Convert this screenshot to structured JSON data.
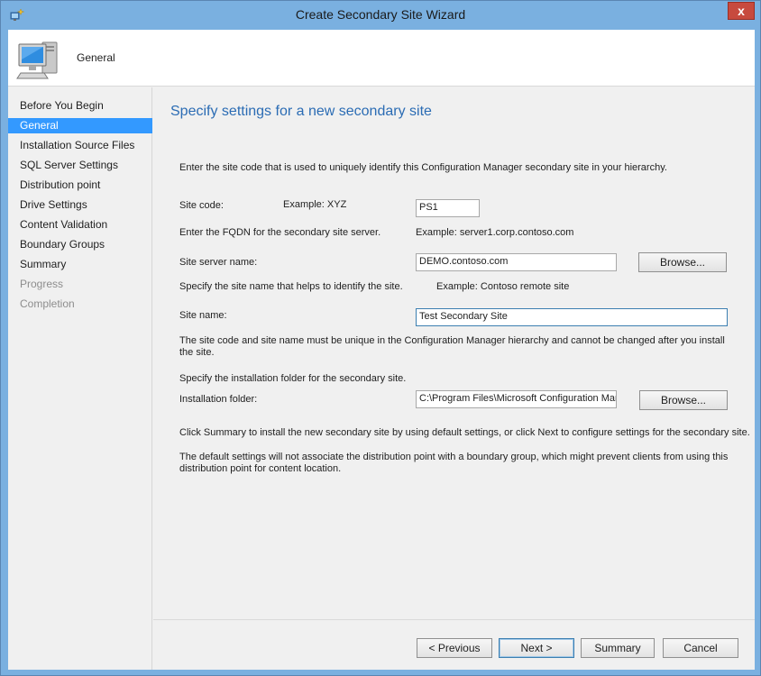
{
  "window": {
    "title": "Create Secondary Site Wizard",
    "close_label": "x"
  },
  "header": {
    "title": "General",
    "icon": "computer-icon"
  },
  "nav": {
    "items": [
      {
        "label": "Before You Begin",
        "state": "normal"
      },
      {
        "label": "General",
        "state": "selected"
      },
      {
        "label": "Installation Source Files",
        "state": "normal"
      },
      {
        "label": "SQL Server Settings",
        "state": "normal"
      },
      {
        "label": "Distribution point",
        "state": "normal"
      },
      {
        "label": "Drive Settings",
        "state": "normal"
      },
      {
        "label": "Content Validation",
        "state": "normal"
      },
      {
        "label": "Boundary Groups",
        "state": "normal"
      },
      {
        "label": "Summary",
        "state": "normal"
      },
      {
        "label": "Progress",
        "state": "disabled"
      },
      {
        "label": "Completion",
        "state": "disabled"
      }
    ]
  },
  "page": {
    "heading": "Specify settings for a new secondary site",
    "intro": "Enter the site code that is used to uniquely identify this Configuration Manager secondary site in your hierarchy.",
    "site_code": {
      "label": "Site code:",
      "example": "Example: XYZ",
      "value": "PS1"
    },
    "fqdn_note": "Enter the FQDN for the secondary site server.",
    "fqdn_example": "Example: server1.corp.contoso.com",
    "site_server": {
      "label": "Site server name:",
      "value": "DEMO.contoso.com",
      "browse_label": "Browse..."
    },
    "site_name_note": "Specify the site name that helps to identify the site.",
    "site_name_example": "Example: Contoso remote site",
    "site_name": {
      "label": "Site name:",
      "value": "Test Secondary Site"
    },
    "unique_note": "The site code and site name must be unique in the Configuration Manager hierarchy and cannot be changed after you install the site.",
    "folder_note": "Specify the installation folder for the secondary site.",
    "install_folder": {
      "label": "Installation folder:",
      "value": "C:\\Program Files\\Microsoft Configuration Manager",
      "browse_label": "Browse..."
    },
    "summary_note": "Click Summary to install the new secondary site by using default settings, or click Next to configure settings for the secondary site.",
    "boundary_note": "The default settings will not associate the distribution point with a boundary group, which might prevent clients from using this distribution point for content location."
  },
  "footer": {
    "previous_label": "< Previous",
    "next_label": "Next >",
    "summary_label": "Summary",
    "cancel_label": "Cancel"
  },
  "colors": {
    "title_bar": "#7ab0e0",
    "selected_nav": "#3399ff",
    "heading": "#2b6cb4",
    "close_button": "#c74a3e"
  }
}
